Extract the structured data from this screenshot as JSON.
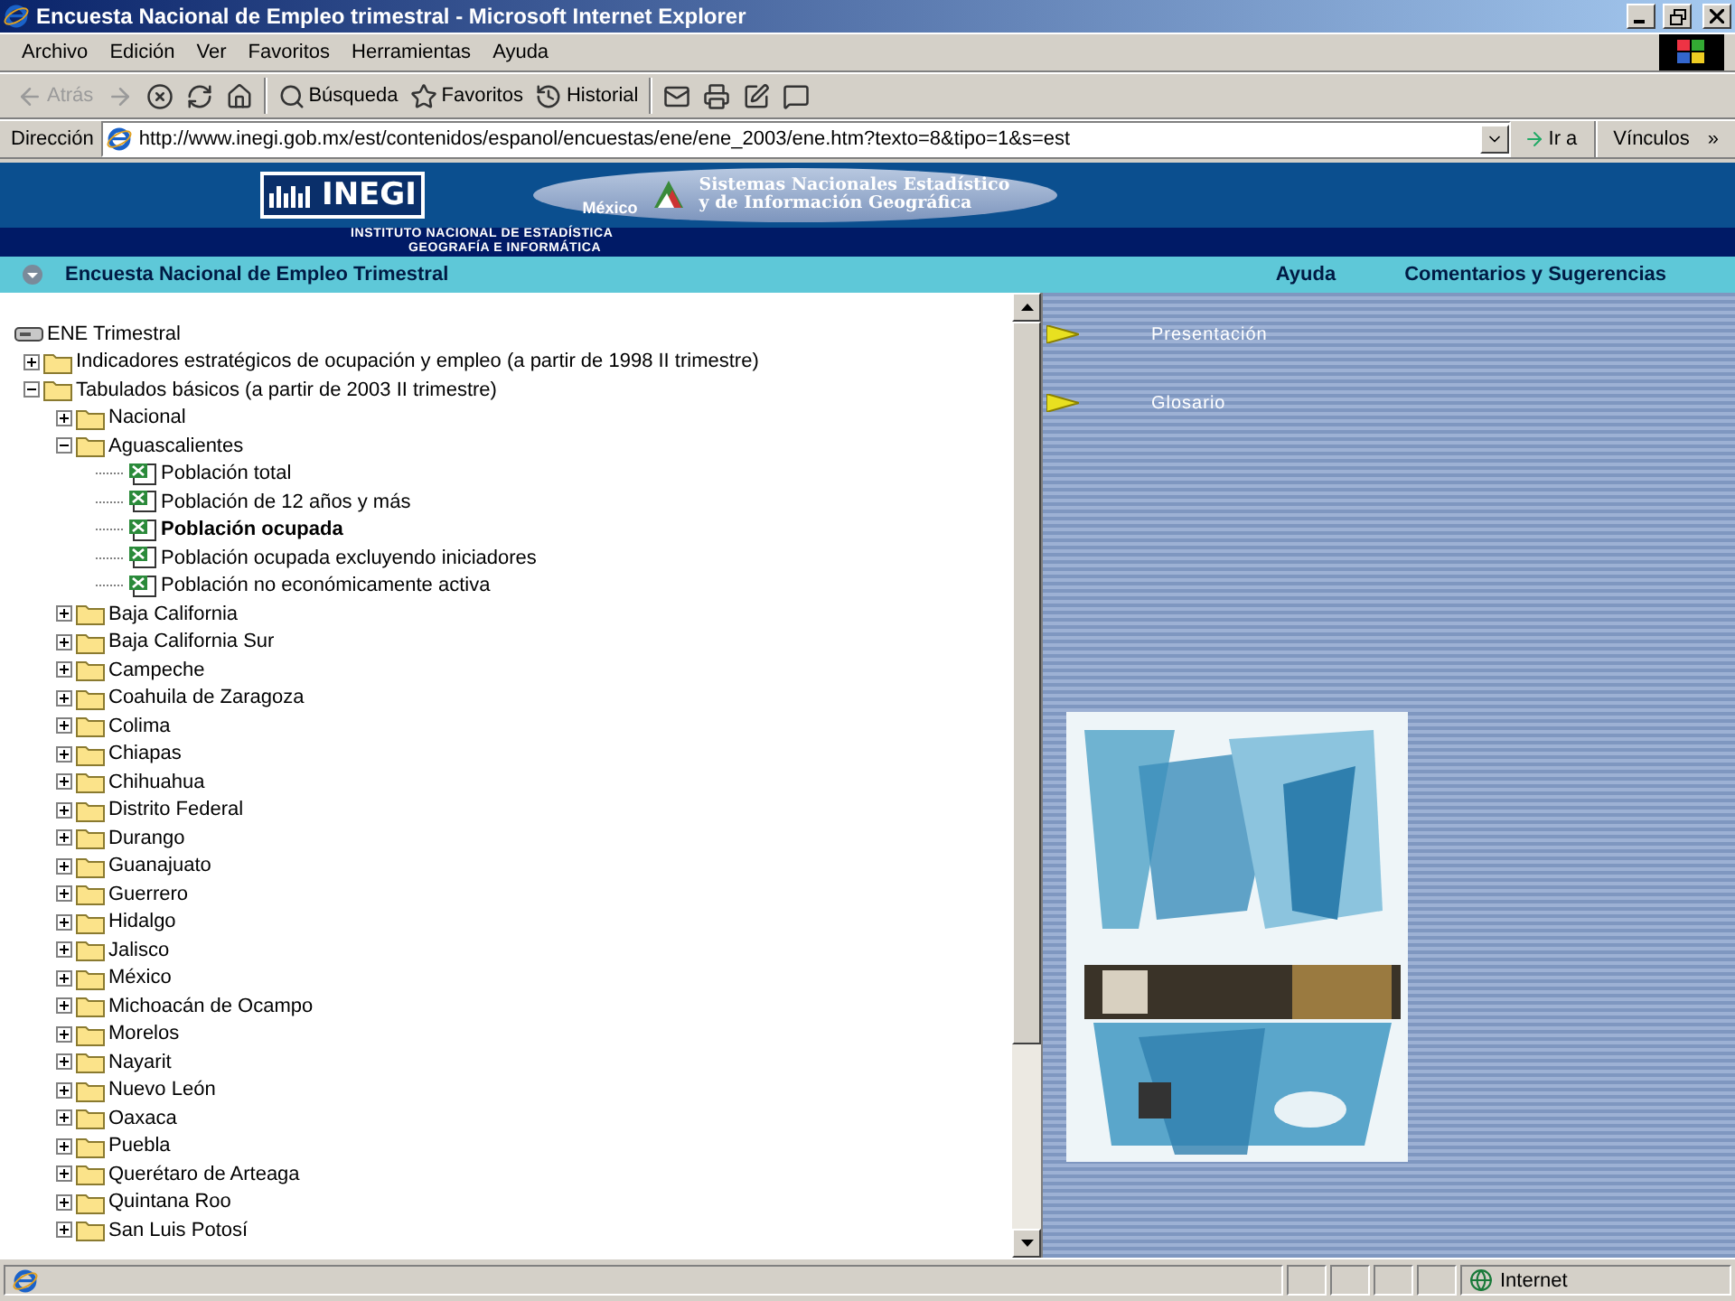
{
  "window": {
    "title": "Encuesta Nacional de Empleo trimestral - Microsoft Internet Explorer"
  },
  "menu": [
    "Archivo",
    "Edición",
    "Ver",
    "Favoritos",
    "Herramientas",
    "Ayuda"
  ],
  "toolbar": [
    {
      "kind": "back",
      "label": "Atrás",
      "disabled": true
    },
    {
      "kind": "forward",
      "disabled": true
    },
    {
      "kind": "stop",
      "disabled": false
    },
    {
      "kind": "refresh",
      "disabled": false
    },
    {
      "kind": "home",
      "disabled": false
    },
    {
      "kind": "search",
      "label": "Búsqueda",
      "disabled": false
    },
    {
      "kind": "favorites",
      "label": "Favoritos",
      "disabled": false
    },
    {
      "kind": "history",
      "label": "Historial",
      "disabled": false
    },
    {
      "kind": "mail",
      "disabled": false
    },
    {
      "kind": "print",
      "disabled": false
    },
    {
      "kind": "edit",
      "disabled": false
    },
    {
      "kind": "discuss",
      "disabled": false
    }
  ],
  "address": {
    "label": "Dirección",
    "value": "http://www.inegi.gob.mx/est/contenidos/espanol/encuestas/ene/ene_2003/ene.htm?texto=8&tipo=1&s=est",
    "go": "Ir a",
    "links": "Vínculos",
    "more": "»"
  },
  "site": {
    "logo": "INEGI",
    "institute": [
      "INSTITUTO NACIONAL DE ESTADÍSTICA",
      "GEOGRAFÍA E INFORMÁTICA"
    ],
    "system": [
      "Sistemas Nacionales Estadístico",
      "y de Información Geográfica"
    ],
    "country": "México"
  },
  "section_bar": {
    "title": "Encuesta Nacional de Empleo Trimestral",
    "links": [
      "Ayuda",
      "Comentarios y Sugerencias"
    ]
  },
  "tree": {
    "kind": "root",
    "label": "ENE Trimestral",
    "children": [
      {
        "kind": "folder",
        "label": "Indicadores estratégicos de ocupación y empleo (a partir de 1998 II trimestre)",
        "expanded": false
      },
      {
        "kind": "folder",
        "label": "Tabulados básicos (a partir de 2003 II trimestre)",
        "expanded": true,
        "children": [
          {
            "kind": "folder",
            "label": "Nacional",
            "expanded": false
          },
          {
            "kind": "folder",
            "label": "Aguascalientes",
            "expanded": true,
            "children": [
              {
                "kind": "file",
                "label": "Población total",
                "selected": false
              },
              {
                "kind": "file",
                "label": "Población de 12 años y más",
                "selected": false
              },
              {
                "kind": "file",
                "label": "Población ocupada",
                "selected": true
              },
              {
                "kind": "file",
                "label": "Población ocupada excluyendo iniciadores",
                "selected": false
              },
              {
                "kind": "file",
                "label": "Población no económicamente activa",
                "selected": false
              }
            ]
          },
          {
            "kind": "folder",
            "label": "Baja California",
            "expanded": false
          },
          {
            "kind": "folder",
            "label": "Baja California Sur",
            "expanded": false
          },
          {
            "kind": "folder",
            "label": "Campeche",
            "expanded": false
          },
          {
            "kind": "folder",
            "label": "Coahuila de Zaragoza",
            "expanded": false
          },
          {
            "kind": "folder",
            "label": "Colima",
            "expanded": false
          },
          {
            "kind": "folder",
            "label": "Chiapas",
            "expanded": false
          },
          {
            "kind": "folder",
            "label": "Chihuahua",
            "expanded": false
          },
          {
            "kind": "folder",
            "label": "Distrito Federal",
            "expanded": false
          },
          {
            "kind": "folder",
            "label": "Durango",
            "expanded": false
          },
          {
            "kind": "folder",
            "label": "Guanajuato",
            "expanded": false
          },
          {
            "kind": "folder",
            "label": "Guerrero",
            "expanded": false
          },
          {
            "kind": "folder",
            "label": "Hidalgo",
            "expanded": false
          },
          {
            "kind": "folder",
            "label": "Jalisco",
            "expanded": false
          },
          {
            "kind": "folder",
            "label": "México",
            "expanded": false
          },
          {
            "kind": "folder",
            "label": "Michoacán de Ocampo",
            "expanded": false
          },
          {
            "kind": "folder",
            "label": "Morelos",
            "expanded": false
          },
          {
            "kind": "folder",
            "label": "Nayarit",
            "expanded": false
          },
          {
            "kind": "folder",
            "label": "Nuevo León",
            "expanded": false
          },
          {
            "kind": "folder",
            "label": "Oaxaca",
            "expanded": false
          },
          {
            "kind": "folder",
            "label": "Puebla",
            "expanded": false
          },
          {
            "kind": "folder",
            "label": "Querétaro de Arteaga",
            "expanded": false
          },
          {
            "kind": "folder",
            "label": "Quintana Roo",
            "expanded": false
          },
          {
            "kind": "folder",
            "label": "San Luis Potosí",
            "expanded": false
          }
        ]
      }
    ]
  },
  "side_menu": [
    "Presentación",
    "Glosario"
  ],
  "status_bar": {
    "zone": "Internet"
  }
}
